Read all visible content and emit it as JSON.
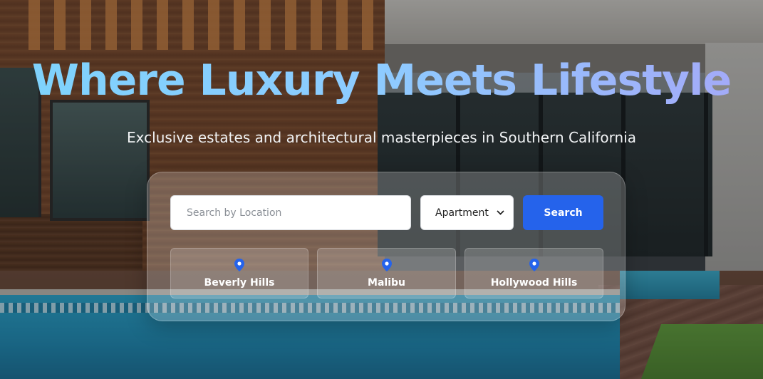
{
  "hero": {
    "title": "Where Luxury Meets Lifestyle",
    "subtitle": "Exclusive estates and architectural masterpieces in Southern California"
  },
  "search": {
    "placeholder": "Search by Location",
    "type_value": "Apartment",
    "button_label": "Search"
  },
  "locations": [
    {
      "label": "Beverly Hills",
      "icon": "map-pin-icon"
    },
    {
      "label": "Malibu",
      "icon": "map-pin-icon"
    },
    {
      "label": "Hollywood Hills",
      "icon": "map-pin-icon"
    }
  ],
  "colors": {
    "accent": "#2563eb",
    "title_gradient_start": "#7dd3fc",
    "title_gradient_end": "#a5a8f8"
  }
}
